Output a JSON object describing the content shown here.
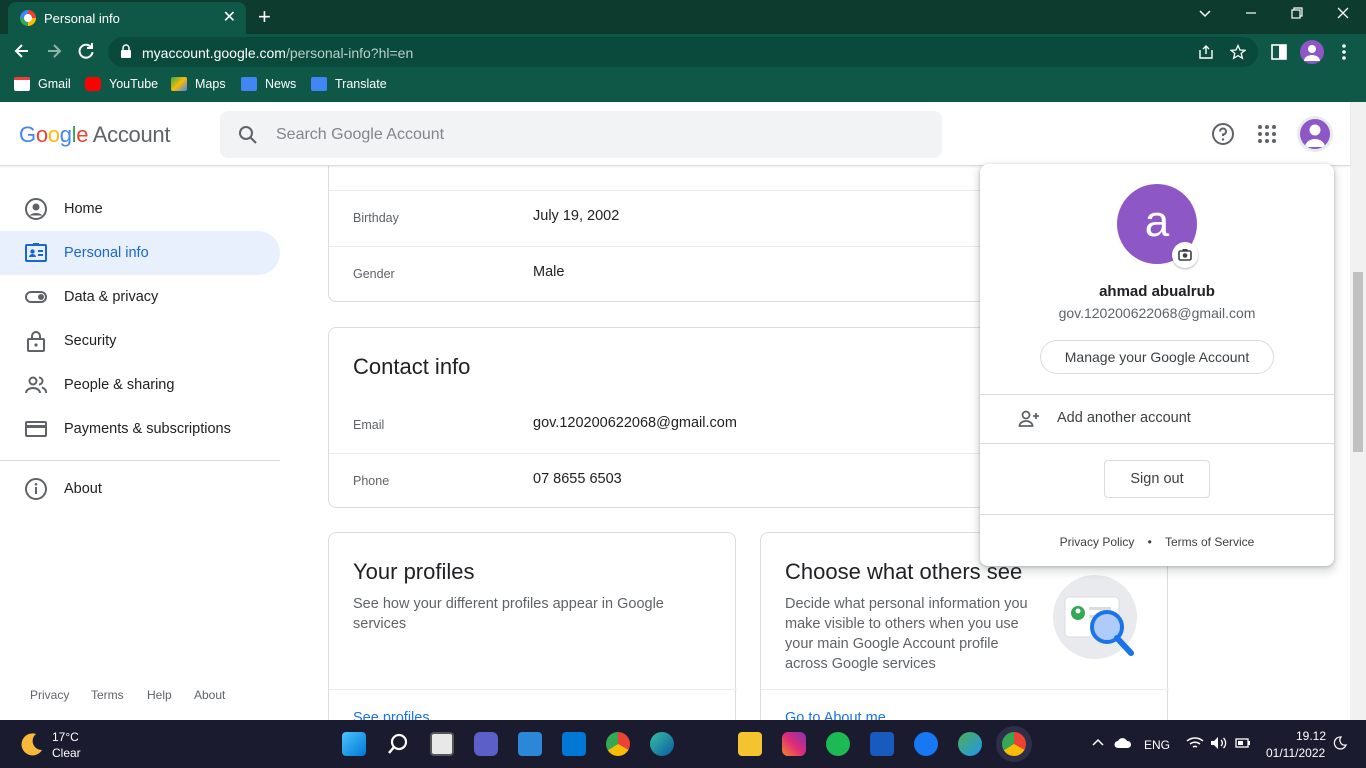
{
  "browser": {
    "tab_title": "Personal info",
    "tab_close": "✕",
    "new_tab": "+",
    "url_host": "myaccount.google.com",
    "url_path": "/personal-info?hl=en",
    "bookmarks": [
      "Gmail",
      "YouTube",
      "Maps",
      "News",
      "Translate"
    ],
    "colors": {
      "frame": "#0d3b2e",
      "toolbar": "#0f5848"
    }
  },
  "header": {
    "logo_google": "Google",
    "logo_account": "Account",
    "search_placeholder": "Search Google Account",
    "icons": [
      "search-icon",
      "help-icon",
      "apps-grid-icon",
      "avatar"
    ]
  },
  "sidebar": {
    "items": [
      {
        "label": "Home",
        "icon": "home-icon",
        "active": false
      },
      {
        "label": "Personal info",
        "icon": "id-card-icon",
        "active": true
      },
      {
        "label": "Data & privacy",
        "icon": "toggle-icon",
        "active": false
      },
      {
        "label": "Security",
        "icon": "lock-icon",
        "active": false
      },
      {
        "label": "People & sharing",
        "icon": "people-icon",
        "active": false
      },
      {
        "label": "Payments & subscriptions",
        "icon": "card-icon",
        "active": false
      },
      {
        "label": "About",
        "icon": "info-icon",
        "active": false
      }
    ],
    "footer": [
      "Privacy",
      "Terms",
      "Help",
      "About"
    ]
  },
  "main": {
    "basic_rows": [
      {
        "label": "Birthday",
        "value": "July 19, 2002"
      },
      {
        "label": "Gender",
        "value": "Male"
      }
    ],
    "contact": {
      "title": "Contact info",
      "rows": [
        {
          "label": "Email",
          "value": "gov.120200622068@gmail.com"
        },
        {
          "label": "Phone",
          "value": "07 8655 6503"
        }
      ]
    },
    "profiles": {
      "title": "Your profiles",
      "desc": "See how your different profiles appear in Google services",
      "link": "See profiles"
    },
    "others": {
      "title": "Choose what others see",
      "desc": "Decide what personal information you make visible to others when you use your main Google Account profile across Google services",
      "link": "Go to About me"
    }
  },
  "account_popup": {
    "avatar_letter": "a",
    "name": "ahmad abualrub",
    "email": "gov.120200622068@gmail.com",
    "manage_label": "Manage your Google Account",
    "add_account_label": "Add another account",
    "sign_out_label": "Sign out",
    "privacy_label": "Privacy Policy",
    "separator": "•",
    "terms_label": "Terms of Service"
  },
  "taskbar": {
    "weather_temp": "17°C",
    "weather_desc": "Clear",
    "lang": "ENG",
    "time": "19.12",
    "date": "01/11/2022"
  }
}
